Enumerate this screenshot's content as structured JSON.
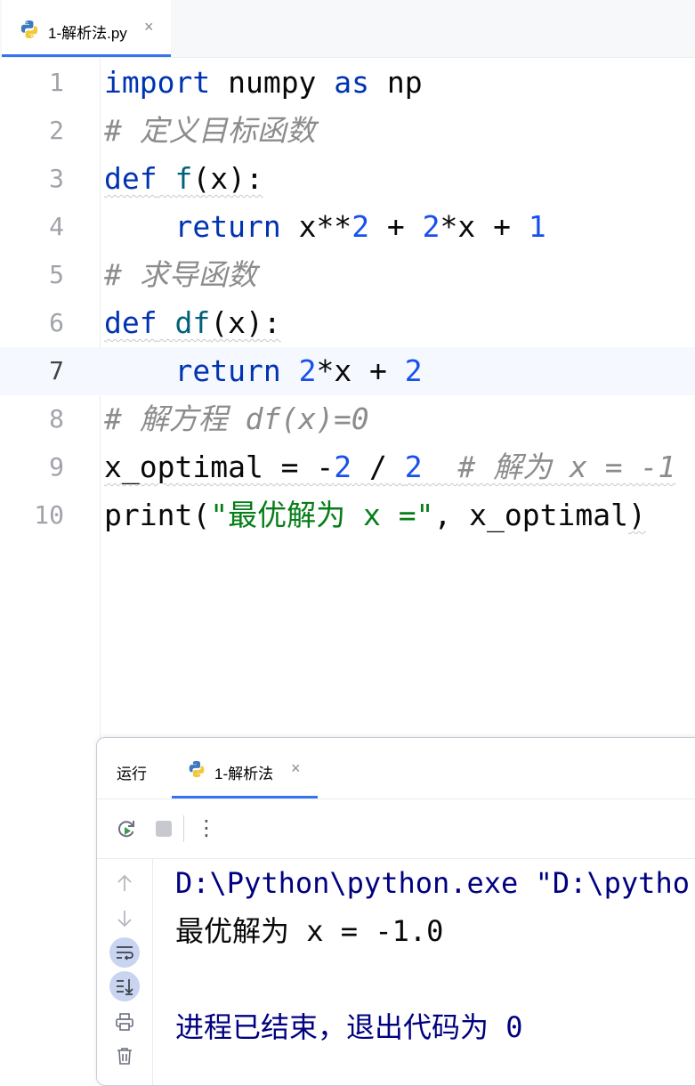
{
  "editor": {
    "tab": {
      "label": "1-解析法.py",
      "close": "×"
    },
    "lines": [
      {
        "n": "1",
        "tokens": [
          {
            "t": "import",
            "c": "kw"
          },
          {
            "t": " numpy ",
            "c": ""
          },
          {
            "t": "as",
            "c": "kw"
          },
          {
            "t": " np",
            "c": ""
          }
        ]
      },
      {
        "n": "2",
        "tokens": [
          {
            "t": "# 定义目标函数",
            "c": "cmt"
          }
        ]
      },
      {
        "n": "3",
        "tokens": [
          {
            "t": "def",
            "c": "kw squig"
          },
          {
            "t": " ",
            "c": "squig"
          },
          {
            "t": "f",
            "c": "fn squig"
          },
          {
            "t": "(x):",
            "c": "squig"
          }
        ]
      },
      {
        "n": "4",
        "tokens": [
          {
            "t": "    ",
            "c": ""
          },
          {
            "t": "return",
            "c": "kw"
          },
          {
            "t": " x**",
            "c": ""
          },
          {
            "t": "2",
            "c": "num"
          },
          {
            "t": " + ",
            "c": ""
          },
          {
            "t": "2",
            "c": "num"
          },
          {
            "t": "*x + ",
            "c": ""
          },
          {
            "t": "1",
            "c": "num"
          }
        ]
      },
      {
        "n": "5",
        "tokens": [
          {
            "t": "# 求导函数",
            "c": "cmt"
          }
        ]
      },
      {
        "n": "6",
        "tokens": [
          {
            "t": "def",
            "c": "kw squig"
          },
          {
            "t": " ",
            "c": "squig"
          },
          {
            "t": "df",
            "c": "fn squig"
          },
          {
            "t": "(x):",
            "c": "squig"
          }
        ]
      },
      {
        "n": "7",
        "current": true,
        "tokens": [
          {
            "t": "    ",
            "c": ""
          },
          {
            "t": "return",
            "c": "kw"
          },
          {
            "t": " ",
            "c": ""
          },
          {
            "t": "2",
            "c": "num"
          },
          {
            "t": "*x + ",
            "c": ""
          },
          {
            "t": "2",
            "c": "num"
          }
        ]
      },
      {
        "n": "8",
        "tokens": [
          {
            "t": "# 解方程 df(x)=0",
            "c": "cmt"
          }
        ]
      },
      {
        "n": "9",
        "tokens": [
          {
            "t": "x_optimal = -",
            "c": "squig"
          },
          {
            "t": "2",
            "c": "num squig"
          },
          {
            "t": " / ",
            "c": "squig"
          },
          {
            "t": "2",
            "c": "num squig"
          },
          {
            "t": "  ",
            "c": "squig"
          },
          {
            "t": "# 解为 x = -1",
            "c": "cmt squig"
          }
        ]
      },
      {
        "n": "10",
        "tokens": [
          {
            "t": "print",
            "c": ""
          },
          {
            "t": "(",
            "c": ""
          },
          {
            "t": "\"最优解为 x =\"",
            "c": "str"
          },
          {
            "t": ", x_optimal",
            "c": ""
          },
          {
            "t": ")",
            "c": "squig"
          }
        ]
      }
    ]
  },
  "run_panel": {
    "title": "运行",
    "tab": {
      "label": "1-解析法",
      "close": "×"
    },
    "toolbar": {
      "more": "⋮"
    },
    "console": {
      "cmd": "D:\\Python\\python.exe \"D:\\pytho",
      "output": "最优解为 x = -1.0",
      "blank": "",
      "exit": "进程已结束，退出代码为 0"
    }
  },
  "colors": {
    "accent": "#3574f0",
    "keyword": "#0033b3",
    "number": "#1750eb",
    "string": "#067d17",
    "comment": "#8c8c8c"
  }
}
